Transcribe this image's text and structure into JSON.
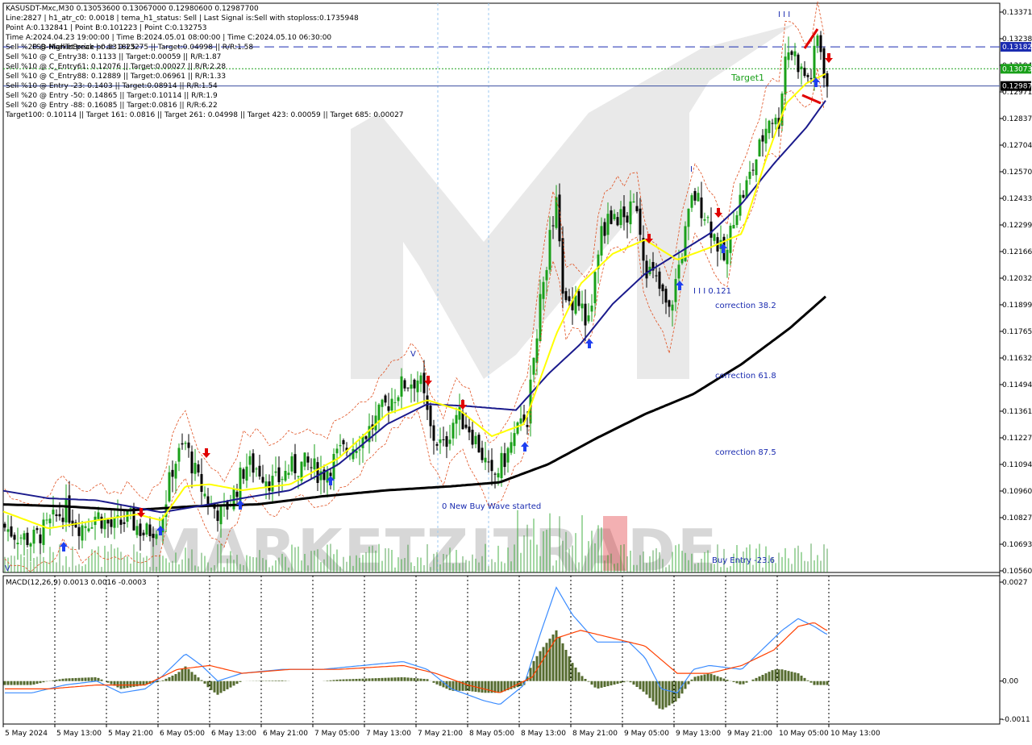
{
  "window": {
    "symbol_header": "KASUSDT-Mxc,M30  0.13053600 0.13067000 0.12980600 0.12987700"
  },
  "info_lines": [
    "Line:2827  |  h1_atr_c0: 0.0018  |  tema_h1_status: Sell  |  Last Signal is:Sell with stoploss:0.1735948",
    "Point A:0.132841  |  Point B:0.101223  |  Point C:0.132753",
    "Time A:2024.04.23 19:00:00  |  Time B:2024.05.01 08:00:00  |  Time C:2024.05.10 06:30:00",
    "Sell %20 @ Market price or at: 0.13275  ||  Target:0.04998  ||  R/R:1.58",
    "Sell %10 @ C_Entry38: 0.1133  ||  Target:0.00059  ||  R/R:1.87",
    "Sell %10 @ C_Entry61: 0.12076  ||  Target:0.00027  ||  R/R:2.28",
    "Sell %10 @ C_Entry88: 0.12889  ||  Target:0.06961  ||  R/R:1.33",
    "Sell %10 @ Entry -23: 0.1403  ||  Target:0.08914  ||  R/R:1.54",
    "Sell %20 @ Entry -50: 0.14865  ||  Target:0.10114  ||  R/R:1.9",
    "Sell %20 @ Entry -88: 0.16085  ||  Target:0.0816  ||  R/R:6.22",
    "Target100: 0.10114  ||  Target 161: 0.0816  ||  Target 261: 0.04998  ||  Target 423: 0.00059  ||  Target 685: 0.00027"
  ],
  "overlay_text": "FSB-HighToBreak | 0.131825",
  "annotations": {
    "target1": "Target1",
    "wave_III_top": "I I I",
    "wave_I": "I",
    "wave_V": "V",
    "wave_V_low": "V",
    "level_0121": "I I I 0.121",
    "corr_382": "correction 38.2",
    "corr_618": "correction 61.8",
    "corr_875": "correction 87.5",
    "new_buy_wave": "0 New Buy Wave started",
    "buy_entry": "Buy Entry -23.6"
  },
  "price_axis": {
    "ticks": [
      "0.13371",
      "0.13238",
      "0.13104",
      "0.12971",
      "0.12837",
      "0.12704",
      "0.12570",
      "0.12433",
      "0.12299",
      "0.12166",
      "0.12032",
      "0.11899",
      "0.11765",
      "0.11632",
      "0.11494",
      "0.11361",
      "0.11227",
      "0.11094",
      "0.10960",
      "0.10827",
      "0.10693",
      "0.10560"
    ],
    "markers": [
      {
        "label": "0.13182",
        "color": "#1a2bb0"
      },
      {
        "label": "0.13073",
        "color": "#1aa01a"
      },
      {
        "label": "0.12987",
        "color": "#000000"
      }
    ]
  },
  "time_axis": [
    "5 May 2024",
    "5 May 13:00",
    "5 May 21:00",
    "6 May 05:00",
    "6 May 13:00",
    "6 May 21:00",
    "7 May 05:00",
    "7 May 13:00",
    "7 May 21:00",
    "8 May 05:00",
    "8 May 13:00",
    "8 May 21:00",
    "9 May 05:00",
    "9 May 13:00",
    "9 May 21:00",
    "10 May 05:00",
    "10 May 13:00"
  ],
  "macd": {
    "label": "MACD(12,26,9) 0.0013 0.0016 -0.0003",
    "ticks": [
      "0.0027",
      "0.00",
      "-0.0011"
    ]
  },
  "watermark": "MARKETZITRADE",
  "colors": {
    "bull": "#1aa01a",
    "bear": "#000000",
    "ma_fast": "#ffff00",
    "ma_mid": "#1a1a8c",
    "ma_slow": "#000000",
    "signal_up": "#1f3ff0",
    "signal_down": "#e00000",
    "macd_line": "#3b8cff",
    "macd_signal": "#ff4000",
    "macd_hist": "#556b2f"
  },
  "chart_data": {
    "type": "candlestick",
    "symbol": "KASUSDT-Mxc",
    "timeframe": "M30",
    "ylim": [
      0.1056,
      0.134
    ],
    "x_labels": [
      "5 May 2024",
      "5 May 13:00",
      "5 May 21:00",
      "6 May 05:00",
      "6 May 13:00",
      "6 May 21:00",
      "7 May 05:00",
      "7 May 13:00",
      "7 May 21:00",
      "8 May 05:00",
      "8 May 13:00",
      "8 May 21:00",
      "9 May 05:00",
      "9 May 13:00",
      "9 May 21:00",
      "10 May 05:00",
      "10 May 13:00"
    ],
    "close_anchor": [
      [
        0,
        0.108
      ],
      [
        20,
        0.1075
      ],
      [
        40,
        0.1072
      ],
      [
        60,
        0.1079
      ],
      [
        80,
        0.1088
      ],
      [
        100,
        0.1079
      ],
      [
        120,
        0.1085
      ],
      [
        140,
        0.1078
      ],
      [
        160,
        0.1083
      ],
      [
        180,
        0.1075
      ],
      [
        200,
        0.1082
      ],
      [
        215,
        0.111
      ],
      [
        230,
        0.112
      ],
      [
        245,
        0.1102
      ],
      [
        260,
        0.109
      ],
      [
        275,
        0.1085
      ],
      [
        290,
        0.1095
      ],
      [
        305,
        0.111
      ],
      [
        320,
        0.1108
      ],
      [
        340,
        0.11
      ],
      [
        360,
        0.1108
      ],
      [
        380,
        0.111
      ],
      [
        400,
        0.1105
      ],
      [
        420,
        0.1115
      ],
      [
        440,
        0.112
      ],
      [
        460,
        0.1128
      ],
      [
        480,
        0.114
      ],
      [
        500,
        0.115
      ],
      [
        520,
        0.1153
      ],
      [
        535,
        0.1125
      ],
      [
        550,
        0.1118
      ],
      [
        565,
        0.1135
      ],
      [
        580,
        0.113
      ],
      [
        595,
        0.1118
      ],
      [
        610,
        0.1102
      ],
      [
        625,
        0.1112
      ],
      [
        640,
        0.1125
      ],
      [
        655,
        0.1135
      ],
      [
        665,
        0.1175
      ],
      [
        680,
        0.1218
      ],
      [
        690,
        0.1238
      ],
      [
        700,
        0.1188
      ],
      [
        715,
        0.1195
      ],
      [
        730,
        0.118
      ],
      [
        745,
        0.1225
      ],
      [
        760,
        0.1235
      ],
      [
        775,
        0.1232
      ],
      [
        790,
        0.124
      ],
      [
        800,
        0.121
      ],
      [
        815,
        0.12
      ],
      [
        830,
        0.1185
      ],
      [
        845,
        0.1215
      ],
      [
        860,
        0.1245
      ],
      [
        875,
        0.1235
      ],
      [
        890,
        0.122
      ],
      [
        900,
        0.121
      ],
      [
        910,
        0.1235
      ],
      [
        925,
        0.1248
      ],
      [
        940,
        0.1265
      ],
      [
        955,
        0.1285
      ],
      [
        965,
        0.1278
      ],
      [
        975,
        0.1318
      ],
      [
        985,
        0.1315
      ],
      [
        995,
        0.1305
      ],
      [
        1005,
        0.1302
      ],
      [
        1015,
        0.1325
      ],
      [
        1025,
        0.1299
      ]
    ],
    "ma_fast": [
      [
        0,
        0.1087
      ],
      [
        60,
        0.1078
      ],
      [
        120,
        0.1082
      ],
      [
        170,
        0.1085
      ],
      [
        200,
        0.1082
      ],
      [
        230,
        0.1099
      ],
      [
        260,
        0.11
      ],
      [
        300,
        0.1097
      ],
      [
        360,
        0.11
      ],
      [
        420,
        0.1113
      ],
      [
        480,
        0.1135
      ],
      [
        530,
        0.1142
      ],
      [
        570,
        0.1137
      ],
      [
        610,
        0.1124
      ],
      [
        650,
        0.113
      ],
      [
        690,
        0.1175
      ],
      [
        720,
        0.12
      ],
      [
        760,
        0.1215
      ],
      [
        800,
        0.1222
      ],
      [
        840,
        0.1212
      ],
      [
        880,
        0.1218
      ],
      [
        920,
        0.1225
      ],
      [
        950,
        0.1262
      ],
      [
        975,
        0.129
      ],
      [
        1000,
        0.13
      ],
      [
        1025,
        0.1305
      ]
    ],
    "ma_mid": [
      [
        0,
        0.1097
      ],
      [
        60,
        0.1093
      ],
      [
        120,
        0.1092
      ],
      [
        200,
        0.1086
      ],
      [
        260,
        0.109
      ],
      [
        300,
        0.1093
      ],
      [
        360,
        0.1097
      ],
      [
        420,
        0.111
      ],
      [
        480,
        0.113
      ],
      [
        530,
        0.114
      ],
      [
        580,
        0.1139
      ],
      [
        640,
        0.1137
      ],
      [
        680,
        0.1155
      ],
      [
        720,
        0.117
      ],
      [
        760,
        0.119
      ],
      [
        800,
        0.1205
      ],
      [
        840,
        0.1215
      ],
      [
        880,
        0.1225
      ],
      [
        920,
        0.124
      ],
      [
        960,
        0.126
      ],
      [
        1000,
        0.1278
      ],
      [
        1025,
        0.1292
      ]
    ],
    "ma_slow": [
      [
        0,
        0.109
      ],
      [
        80,
        0.1089
      ],
      [
        160,
        0.1087
      ],
      [
        240,
        0.1089
      ],
      [
        320,
        0.109
      ],
      [
        400,
        0.1094
      ],
      [
        480,
        0.1097
      ],
      [
        560,
        0.1099
      ],
      [
        620,
        0.1101
      ],
      [
        680,
        0.111
      ],
      [
        740,
        0.1123
      ],
      [
        800,
        0.1135
      ],
      [
        860,
        0.1145
      ],
      [
        920,
        0.116
      ],
      [
        980,
        0.1178
      ],
      [
        1025,
        0.1194
      ]
    ],
    "levels": [
      {
        "name": "FSB-HighToBreak",
        "value": 0.131825,
        "style": "dashed",
        "color": "#1a2bb0"
      },
      {
        "name": "Target1",
        "value": 0.13073,
        "style": "dotted",
        "color": "#1aa01a"
      },
      {
        "name": "Current",
        "value": 0.12987,
        "style": "solid",
        "color": "#3a4ea0"
      }
    ],
    "macd": {
      "params": "12,26,9",
      "values": {
        "macd": 0.0013,
        "signal": 0.0016,
        "hist": -0.0003
      },
      "ylim": [
        -0.0011,
        0.0027
      ]
    }
  }
}
